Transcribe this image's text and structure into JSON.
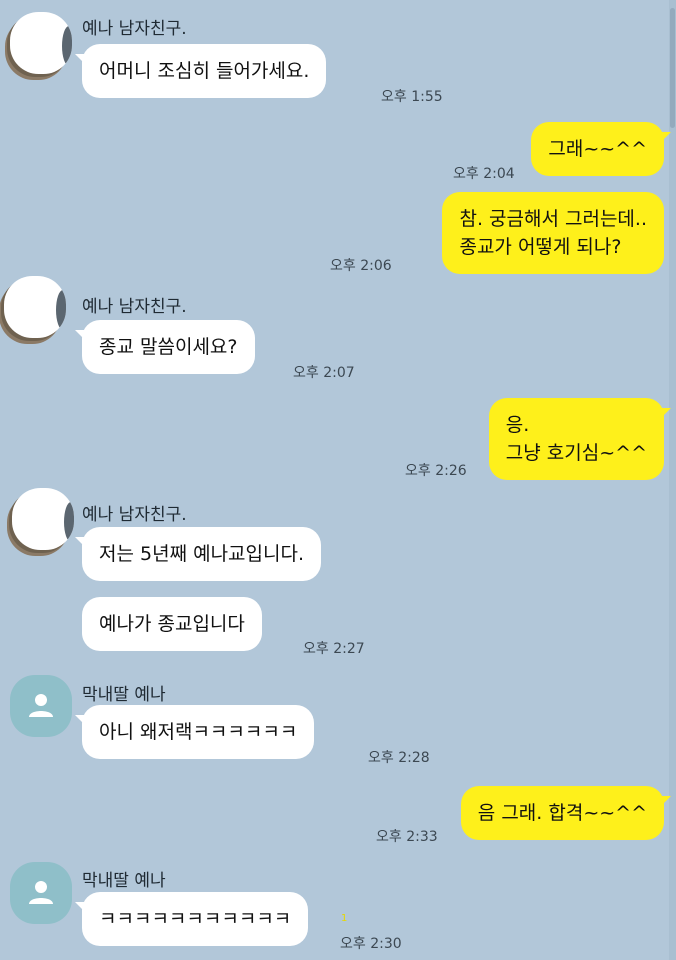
{
  "contacts": {
    "boyfriend": "예나 남자친구.",
    "daughter": "막내딸 예나"
  },
  "messages": [
    {
      "id": "m1",
      "text": "어머니 조심히 들어가세요.",
      "time": "오후 1:55"
    },
    {
      "id": "m2",
      "text": "그래~~^^",
      "time": "오후 2:04"
    },
    {
      "id": "m3",
      "text": "참. 궁금해서 그러는데..\n종교가 어떻게 되나?",
      "time": "오후 2:06"
    },
    {
      "id": "m4",
      "text": "종교 말씀이세요?",
      "time": "오후 2:07"
    },
    {
      "id": "m5",
      "text": "응.\n그냥 호기심~^^",
      "time": "오후 2:26"
    },
    {
      "id": "m6",
      "text": "저는 5년째 예나교입니다.",
      "time": ""
    },
    {
      "id": "m7",
      "text": "예나가 종교입니다",
      "time": "오후 2:27"
    },
    {
      "id": "m8",
      "text": "아니 왜저랙ㅋㅋㅋㅋㅋㅋ",
      "time": "오후 2:28"
    },
    {
      "id": "m9",
      "text": "음 그래. 합격~~^^",
      "time": "오후 2:33"
    },
    {
      "id": "m10",
      "text": "ㅋㅋㅋㅋㅋㅋㅋㅋㅋㅋㅋ",
      "time": "오후 2:30",
      "unread": "1"
    }
  ],
  "colors": {
    "background": "#b2c7d9",
    "outgoing_bubble": "#fef01b",
    "incoming_bubble": "#ffffff",
    "default_avatar": "#8fbfc9"
  },
  "icons": {
    "default_avatar": "person-icon"
  }
}
